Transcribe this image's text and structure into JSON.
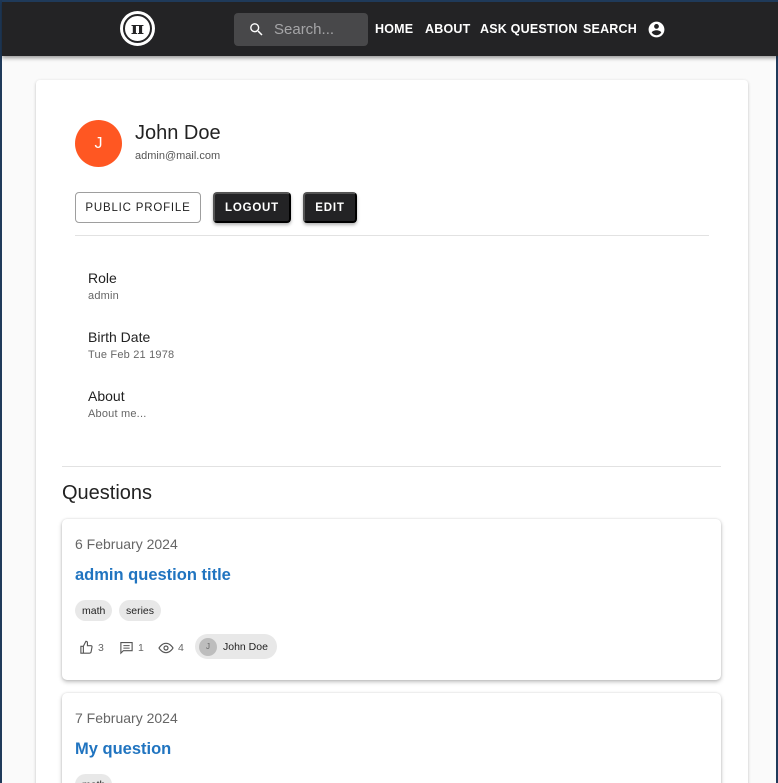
{
  "header": {
    "search_placeholder": "Search...",
    "nav": [
      "HOME",
      "ABOUT",
      "ASK QUESTION",
      "SEARCH"
    ]
  },
  "profile": {
    "avatar_initial": "J",
    "avatar_color": "#ff5722",
    "name": "John Doe",
    "email": "admin@mail.com",
    "buttons": {
      "public_profile": "PUBLIC PROFILE",
      "logout": "LOGOUT",
      "edit": "EDIT"
    },
    "fields": [
      {
        "label": "Role",
        "value": "admin"
      },
      {
        "label": "Birth Date",
        "value": "Tue Feb 21 1978"
      },
      {
        "label": "About",
        "value": "About me..."
      }
    ]
  },
  "questions": {
    "title": "Questions",
    "items": [
      {
        "date": "6 February 2024",
        "title": "admin question title",
        "tags": [
          "math",
          "series"
        ],
        "likes": "3",
        "comments": "1",
        "views": "4",
        "author_initial": "J",
        "author": "John Doe"
      },
      {
        "date": "7 February 2024",
        "title": "My question",
        "tags": [
          "math"
        ]
      }
    ]
  },
  "colors": {
    "link_blue": "#2074c0",
    "topbar": "#232325"
  }
}
